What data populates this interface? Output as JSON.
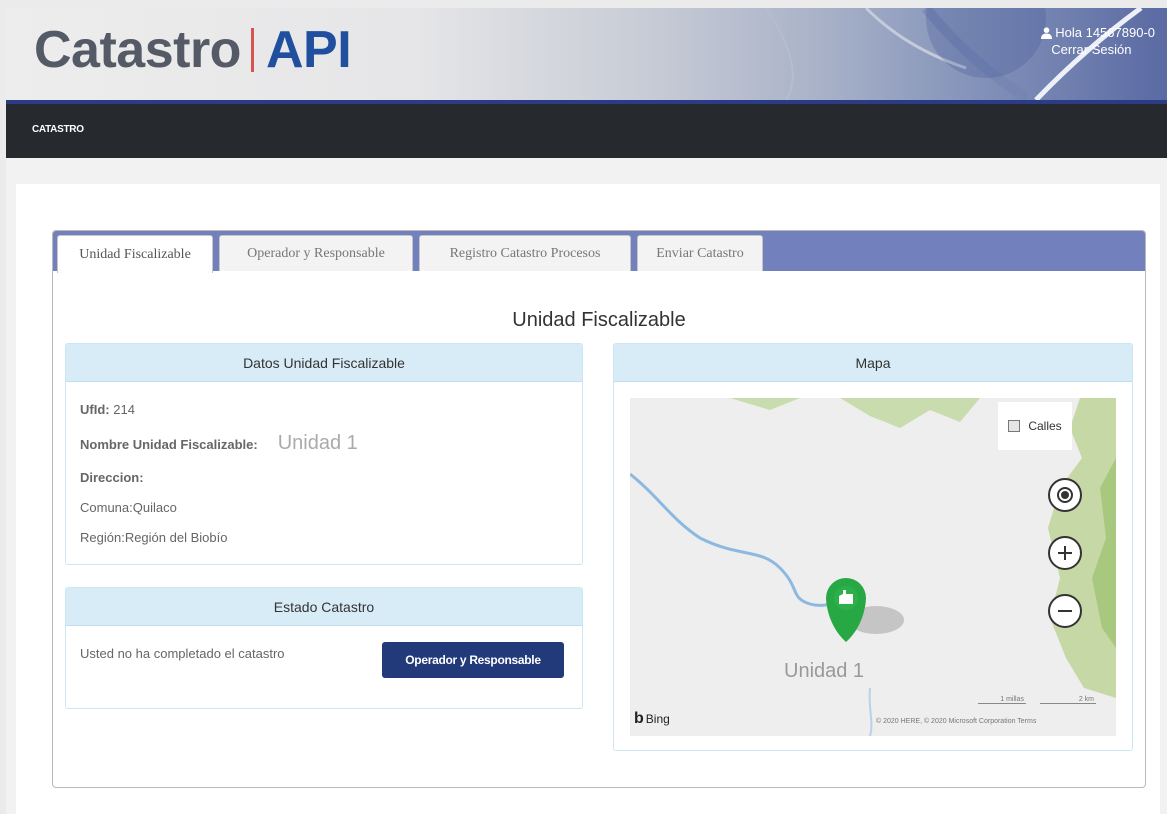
{
  "header": {
    "logo_part1": "Catastro",
    "logo_part2": "API",
    "user_greeting": "Hola 14567890-0",
    "logout_label": "Cerrar Sesión"
  },
  "nav": {
    "items": [
      {
        "label": "CATASTRO"
      }
    ]
  },
  "tabs": [
    {
      "label": "Unidad Fiscalizable",
      "active": true
    },
    {
      "label": "Operador y Responsable",
      "active": false
    },
    {
      "label": "Registro Catastro Procesos",
      "active": false
    },
    {
      "label": "Enviar Catastro",
      "active": false
    }
  ],
  "page_title": "Unidad Fiscalizable",
  "datos_panel": {
    "title": "Datos Unidad Fiscalizable",
    "ufid_label": "UfId:",
    "ufid_value": "214",
    "nombre_label": "Nombre Unidad Fiscalizable:",
    "nombre_value": "Unidad 1",
    "direccion_label": "Direccion:",
    "direccion_value": "",
    "comuna_label": "Comuna:",
    "comuna_value": "Quilaco",
    "region_label": "Región:",
    "region_value": "Región del Biobío"
  },
  "estado_panel": {
    "title": "Estado Catastro",
    "message": "Usted no ha completado el catastro",
    "button_label": "Operador y Responsable"
  },
  "map_panel": {
    "title": "Mapa",
    "layer_label": "Calles",
    "marker_label": "Unidad 1",
    "attribution_logo": "Bing",
    "scale_miles": "1 millas",
    "scale_km": "2 km",
    "copyright": "© 2020 HERE, © 2020 Microsoft Corporation  Terms",
    "controls": [
      "locate-icon",
      "zoom-in-icon",
      "zoom-out-icon"
    ]
  },
  "colors": {
    "brand_blue": "#1f4f9e",
    "logo_divider": "#d9534f",
    "navbar": "#262a2e",
    "tab_strip": "#7281bd",
    "panel_heading": "#d8ecf7",
    "primary_button": "#223a7a",
    "marker": "#27a845"
  }
}
